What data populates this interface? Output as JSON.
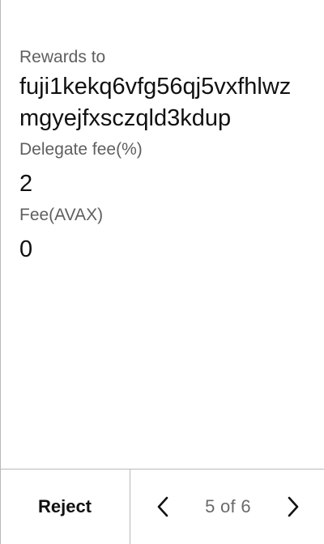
{
  "details": {
    "rewards_label": "Rewards to",
    "rewards_address": "fuji1kekq6vfg56qj5vxfhlwzmgyejfxsczqld3kdup",
    "delegate_fee_label": "Delegate fee(%)",
    "delegate_fee_value": "2",
    "fee_label": "Fee(AVAX)",
    "fee_value": "0"
  },
  "footer": {
    "reject_label": "Reject",
    "page_indicator": "5 of 6",
    "prev_icon": "chevron-left-icon",
    "next_icon": "chevron-right-icon"
  },
  "colors": {
    "text_primary": "#111111",
    "text_secondary": "#5f5f5f",
    "border": "#b9b9b9"
  }
}
